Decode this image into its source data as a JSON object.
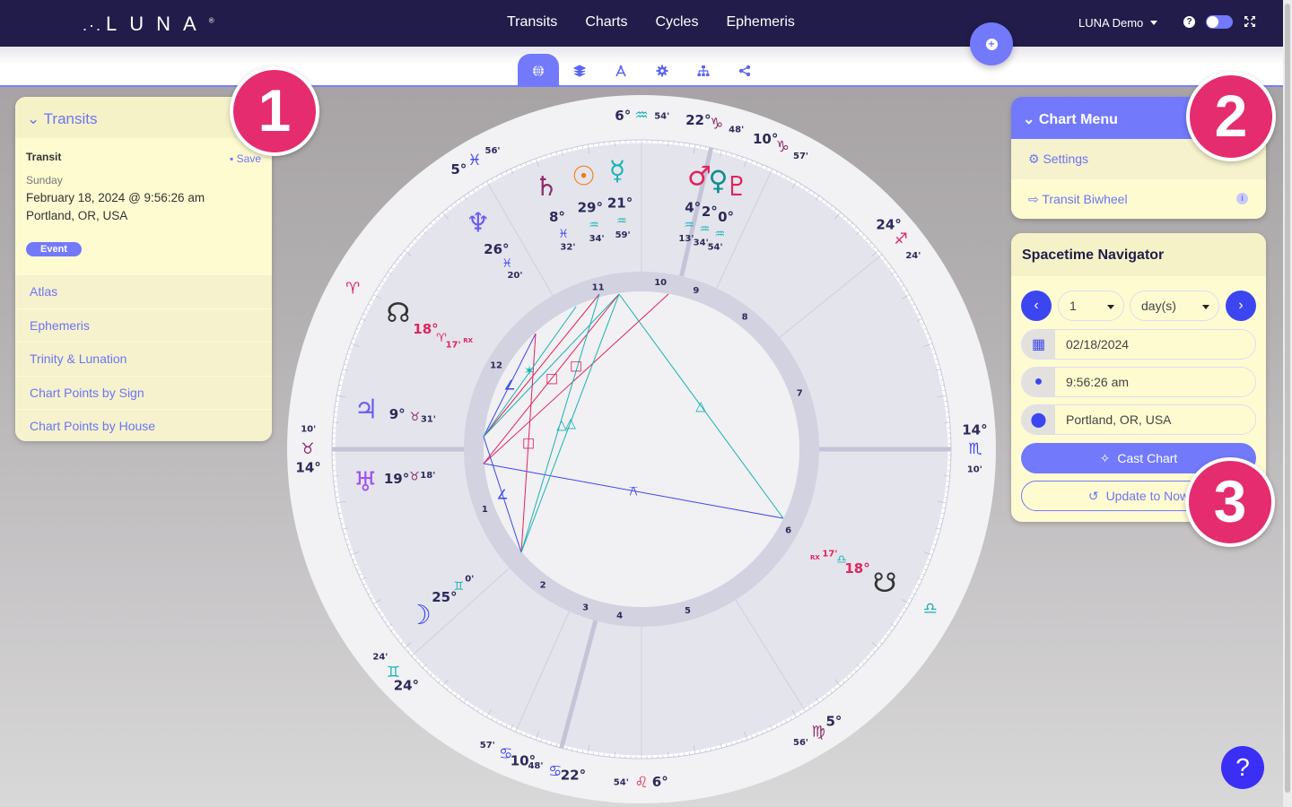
{
  "header": {
    "logo": "LUNA",
    "nav": [
      "Transits",
      "Charts",
      "Cycles",
      "Ephemeris"
    ],
    "user_menu": "LUNA Demo",
    "help_icon": "question-circle-icon",
    "toggle_state": "on",
    "fullscreen_icon": "expand-icon"
  },
  "subtabs": [
    {
      "icon": "globe-icon",
      "active": true
    },
    {
      "icon": "layers-icon",
      "active": false
    },
    {
      "icon": "compass-drafting-icon",
      "active": false
    },
    {
      "icon": "gear-icon",
      "active": false
    },
    {
      "icon": "sitemap-icon",
      "active": false
    },
    {
      "icon": "share-icon",
      "active": false
    }
  ],
  "transits_panel": {
    "title": "Transits",
    "label": "Transit",
    "save": "Save",
    "day": "Sunday",
    "datetime": "February 18, 2024 @ 9:56:26 am",
    "location": "Portland, OR, USA",
    "badge": "Event",
    "links": [
      "Atlas",
      "Ephemeris",
      "Trinity & Lunation",
      "Chart Points by Sign",
      "Chart Points by House"
    ]
  },
  "chart_menu": {
    "title": "Chart Menu",
    "items": [
      {
        "label": "Settings",
        "icon": "gear-icon"
      },
      {
        "label": "Transit Biwheel",
        "icon": "arrow-right-from-arc-icon",
        "info": "i"
      }
    ]
  },
  "spacetime_navigator": {
    "title": "Spacetime Navigator",
    "step_value": "1",
    "step_unit": "day(s)",
    "date": "02/18/2024",
    "time": "9:56:26 am",
    "location": "Portland, OR, USA",
    "cast_button": "Cast Chart",
    "update_button": "Update to Now"
  },
  "markers": [
    "1",
    "2",
    "3"
  ],
  "help_fab": "?",
  "colors": {
    "brand_dark": "#221c4a",
    "accent": "#7279fb",
    "marker": "#e42c6f",
    "panel_bg": "#fefbd1"
  },
  "chart": {
    "house_cusps": [
      {
        "house": 1,
        "deg": "14°",
        "sign": "♉",
        "min": "10'",
        "sign_color": "#8b2a6a"
      },
      {
        "house": 2,
        "deg": "24°",
        "sign": "♊",
        "min": "24'",
        "sign_color": "#19b3b5"
      },
      {
        "house": 3,
        "deg": "10°",
        "sign": "♋",
        "min": "57'",
        "sign_color": "#3c46f0"
      },
      {
        "house": 4,
        "deg": "22°",
        "sign": "♋",
        "min": "48'",
        "sign_color": "#3c46f0"
      },
      {
        "house": 5,
        "deg": "6°",
        "sign": "♌",
        "min": "54'",
        "sign_color": "#e0245e"
      },
      {
        "house": 6,
        "deg": "5°",
        "sign": "♍",
        "min": "56'",
        "sign_color": "#8b2a6a"
      },
      {
        "house": 7,
        "deg": "14°",
        "sign": "♏",
        "min": "10'",
        "sign_color": "#3c46f0"
      },
      {
        "house": 8,
        "deg": "24°",
        "sign": "♐",
        "min": "24'",
        "sign_color": "#e0245e"
      },
      {
        "house": 9,
        "deg": "10°",
        "sign": "♑",
        "min": "57'",
        "sign_color": "#8b2a6a"
      },
      {
        "house": 10,
        "deg": "22°",
        "sign": "♑",
        "min": "48'",
        "sign_color": "#8b2a6a"
      },
      {
        "house": 11,
        "deg": "6°",
        "sign": "♒",
        "min": "54'",
        "sign_color": "#19b3b5"
      },
      {
        "house": 12,
        "deg": "5°",
        "sign": "♓",
        "min": "56'",
        "sign_color": "#3c46f0"
      }
    ],
    "intercepted_signs": [
      {
        "sign": "♈",
        "color": "#e0245e"
      },
      {
        "sign": "♎",
        "color": "#19b3b5"
      }
    ],
    "planets": [
      {
        "name": "Sun",
        "glyph": "☉",
        "deg": "29°",
        "sign": "♒",
        "min": "34'",
        "color": "#f07b13"
      },
      {
        "name": "Mercury",
        "glyph": "☿",
        "deg": "21°",
        "sign": "♒",
        "min": "59'",
        "color": "#19b3b5"
      },
      {
        "name": "Mars",
        "glyph": "♂",
        "deg": "4°",
        "sign": "♒",
        "min": "13'",
        "color": "#e0245e"
      },
      {
        "name": "Venus",
        "glyph": "♀",
        "deg": "2°",
        "sign": "♒",
        "min": "34'",
        "color": "#0f8d8f"
      },
      {
        "name": "Pluto",
        "glyph": "♇",
        "deg": "0°",
        "sign": "♒",
        "min": "54'",
        "color": "#e0245e"
      },
      {
        "name": "Saturn",
        "glyph": "♄",
        "deg": "8°",
        "sign": "♓",
        "min": "32'",
        "color": "#8b2a6a"
      },
      {
        "name": "Neptune",
        "glyph": "♆",
        "deg": "26°",
        "sign": "♓",
        "min": "20'",
        "color": "#6a5cf6"
      },
      {
        "name": "North Node",
        "glyph": "☊",
        "deg": "18°",
        "sign": "♈",
        "min": "17'",
        "rx": "RX",
        "color": "#333333",
        "text_color": "#e0245e"
      },
      {
        "name": "Jupiter",
        "glyph": "♃",
        "deg": "9°",
        "sign": "♉",
        "min": "31'",
        "color": "#6a5cf6"
      },
      {
        "name": "Uranus",
        "glyph": "♅",
        "deg": "19°",
        "sign": "♉",
        "min": "18'",
        "color": "#a053f0"
      },
      {
        "name": "Moon",
        "glyph": "☽",
        "deg": "25°",
        "sign": "♊",
        "min": "0'",
        "color": "#3c46f0"
      },
      {
        "name": "South Node",
        "glyph": "☋",
        "deg": "18°",
        "sign": "♎",
        "min": "17'",
        "rx": "RX",
        "color": "#333333",
        "text_color": "#e0245e"
      }
    ],
    "aspect_glyphs": [
      {
        "type": "sextile",
        "glyph": "✶",
        "color": "#19b3b5"
      },
      {
        "type": "square",
        "glyph": "□",
        "color": "#e0245e"
      },
      {
        "type": "square",
        "glyph": "□",
        "color": "#e0245e"
      },
      {
        "type": "square",
        "glyph": "□",
        "color": "#e0245e"
      },
      {
        "type": "trine",
        "glyph": "△",
        "color": "#19b3b5"
      },
      {
        "type": "trine",
        "glyph": "△",
        "color": "#19b3b5"
      },
      {
        "type": "trine",
        "glyph": "△",
        "color": "#19b3b5"
      },
      {
        "type": "semisquare",
        "glyph": "∠",
        "color": "#3c46f0"
      },
      {
        "type": "semisquare",
        "glyph": "∠",
        "color": "#3c46f0"
      },
      {
        "type": "quincunx",
        "glyph": "⚻",
        "color": "#3c46f0"
      }
    ]
  }
}
